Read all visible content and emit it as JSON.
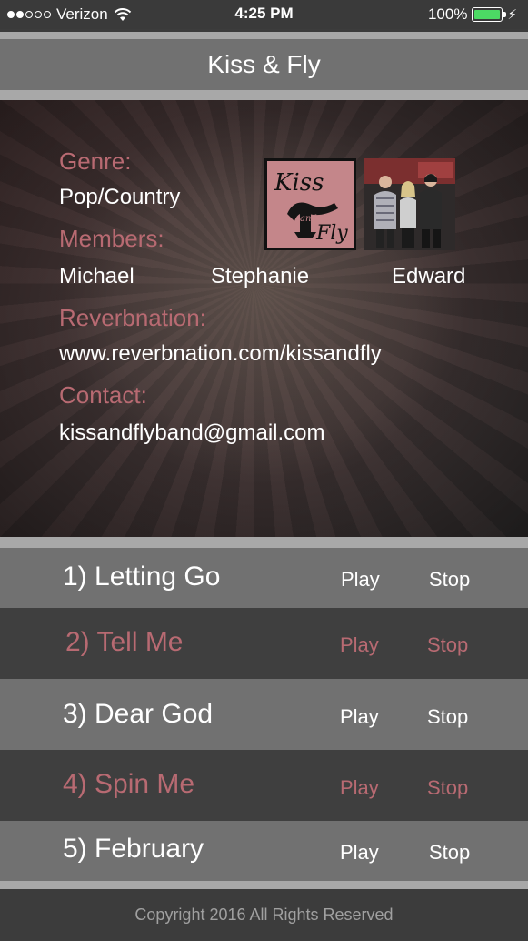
{
  "status_bar": {
    "carrier": "Verizon",
    "time": "4:25 PM",
    "battery": "100%",
    "signal_bars_filled": 2,
    "signal_bars_total": 5
  },
  "header": {
    "title": "Kiss & Fly"
  },
  "info": {
    "genre_label": "Genre:",
    "genre_value": "Pop/Country",
    "members_label": "Members:",
    "members": [
      "Michael",
      "Stephanie",
      "Edward"
    ],
    "reverbnation_label": "Reverbnation:",
    "reverbnation_value": "www.reverbnation.com/kissandfly",
    "contact_label": "Contact:",
    "contact_value": "kissandflyband@gmail.com",
    "logo_text_top": "Kiss",
    "logo_text_mid": "and",
    "logo_text_bottom": "Fly"
  },
  "songs": [
    {
      "title": "1) Letting Go",
      "play": "Play",
      "stop": "Stop"
    },
    {
      "title": "2) Tell Me",
      "play": "Play",
      "stop": "Stop"
    },
    {
      "title": "3) Dear God",
      "play": "Play",
      "stop": "Stop"
    },
    {
      "title": "4) Spin Me",
      "play": "Play",
      "stop": "Stop"
    },
    {
      "title": "5) February",
      "play": "Play",
      "stop": "Stop"
    }
  ],
  "footer": {
    "copyright": "Copyright 2016 All Rights Reserved"
  },
  "colors": {
    "accent_rose": "#b86a72",
    "row_light": "#717171",
    "row_dark": "#3f3f3f",
    "battery_green": "#4cd964"
  }
}
